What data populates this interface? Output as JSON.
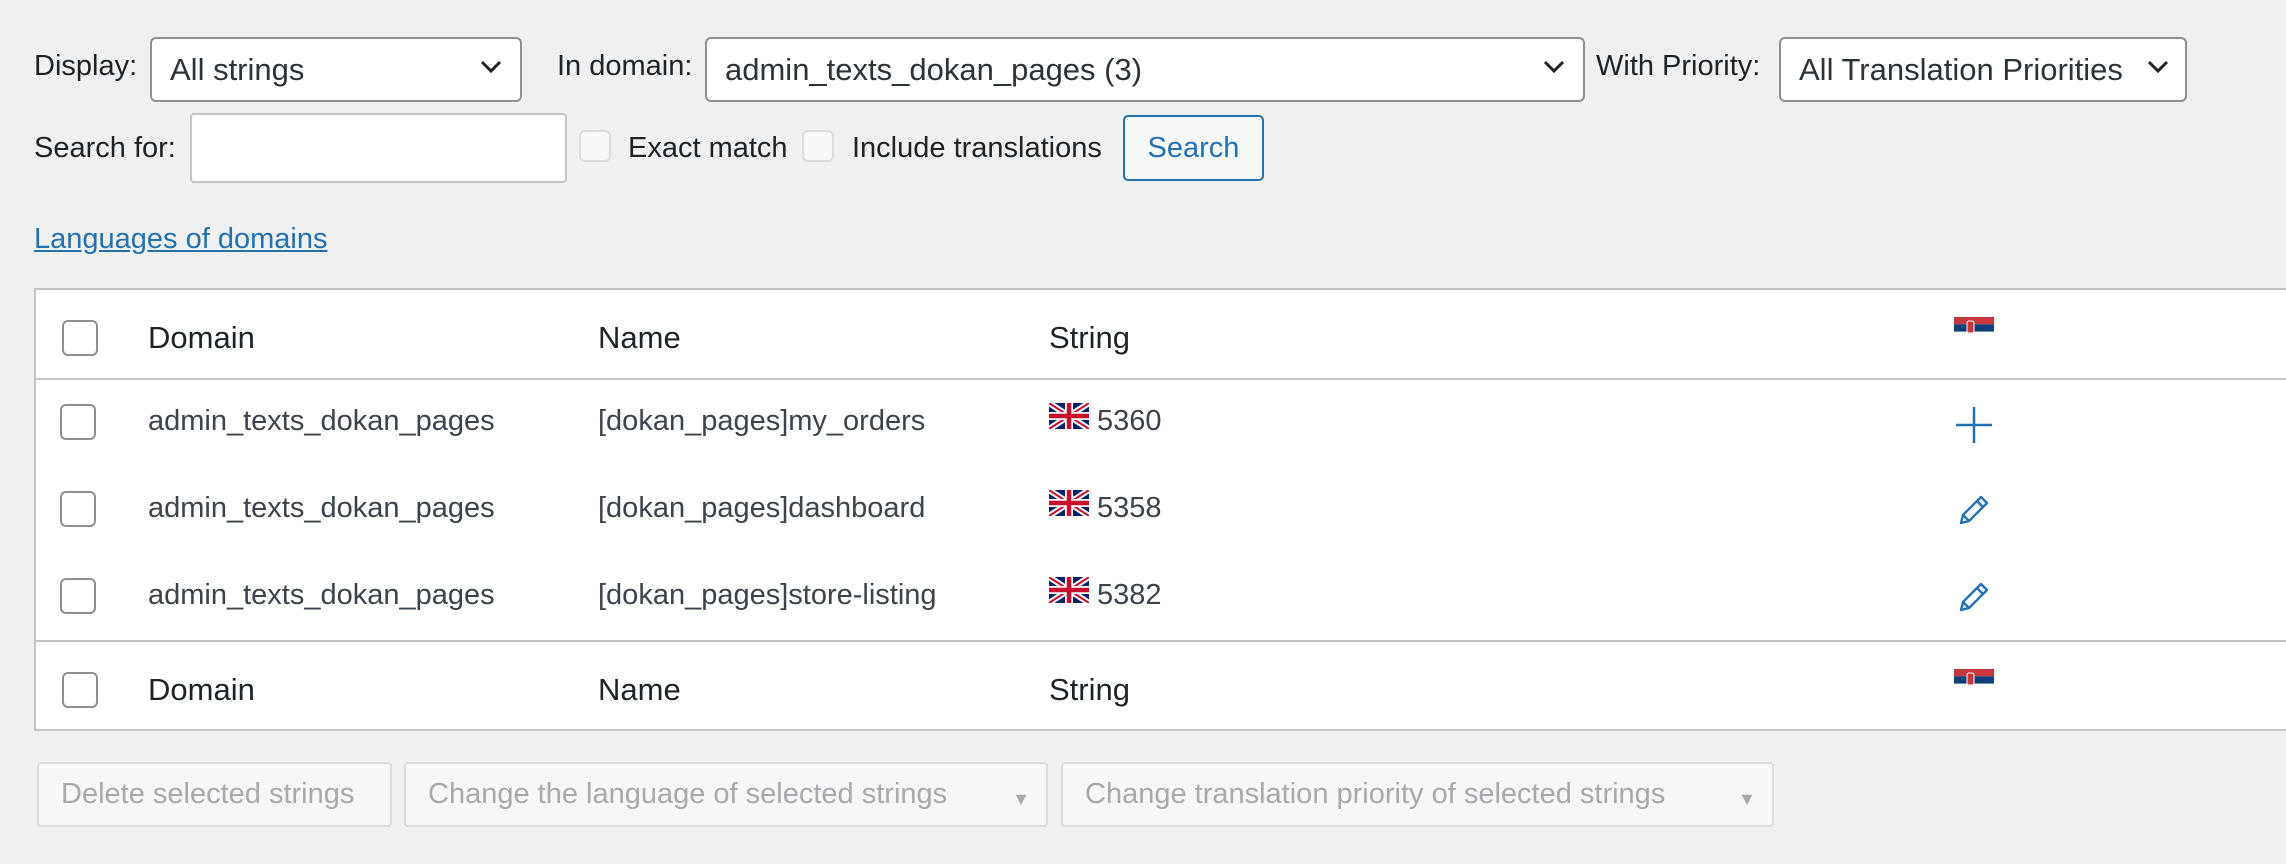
{
  "filters": {
    "display_label": "Display:",
    "display_value": "All strings",
    "domain_label": "In domain:",
    "domain_value": "admin_texts_dokan_pages (3)",
    "priority_label": "With Priority:",
    "priority_value": "All Translation Priorities",
    "search_label": "Search for:",
    "search_value": "",
    "exact_match_label": "Exact match",
    "include_translations_label": "Include translations",
    "search_button": "Search"
  },
  "languages_link": "Languages of domains",
  "table": {
    "columns": [
      "Domain",
      "Name",
      "String"
    ],
    "rows": [
      {
        "domain": "admin_texts_dokan_pages",
        "name": "[dokan_pages]my_orders",
        "string": "5360",
        "action": "plus-icon"
      },
      {
        "domain": "admin_texts_dokan_pages",
        "name": "[dokan_pages]dashboard",
        "string": "5358",
        "action": "pencil-icon"
      },
      {
        "domain": "admin_texts_dokan_pages",
        "name": "[dokan_pages]store-listing",
        "string": "5382",
        "action": "pencil-icon"
      }
    ]
  },
  "bulk": {
    "delete": "Delete selected strings",
    "change_language": "Change the language of selected strings",
    "change_priority": "Change translation priority of selected strings"
  },
  "colors": {
    "accent": "#2271b1",
    "border": "#8c8f94",
    "background": "#f0f0f1",
    "disabled_text": "#a7aaad"
  }
}
